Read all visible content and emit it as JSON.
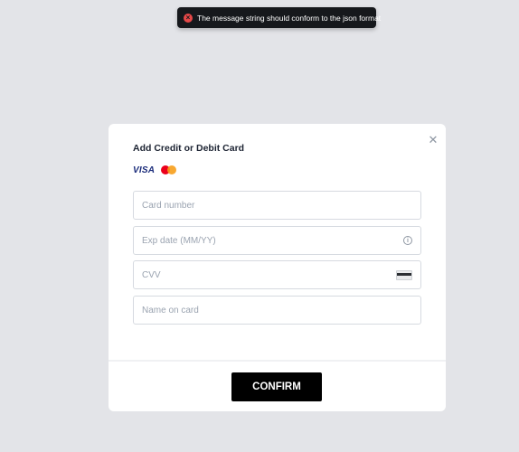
{
  "toast": {
    "icon": "error-icon",
    "message": "The message string should conform to the json format"
  },
  "modal": {
    "title": "Add Credit or Debit Card",
    "close_icon": "close-icon",
    "brands": {
      "visa_label": "VISA",
      "mastercard_icon": "mastercard-icon"
    },
    "fields": {
      "card_number": {
        "placeholder": "Card number",
        "value": ""
      },
      "exp_date": {
        "placeholder": "Exp date (MM/YY)",
        "value": "",
        "icon": "info-icon"
      },
      "cvv": {
        "placeholder": "CVV",
        "value": "",
        "icon": "card-back-icon"
      },
      "name_on_card": {
        "placeholder": "Name on card",
        "value": ""
      }
    },
    "confirm_label": "CONFIRM"
  },
  "colors": {
    "background": "#e3e4e8",
    "toast_bg": "#16181c",
    "error": "#e64848",
    "button_bg": "#000000"
  }
}
